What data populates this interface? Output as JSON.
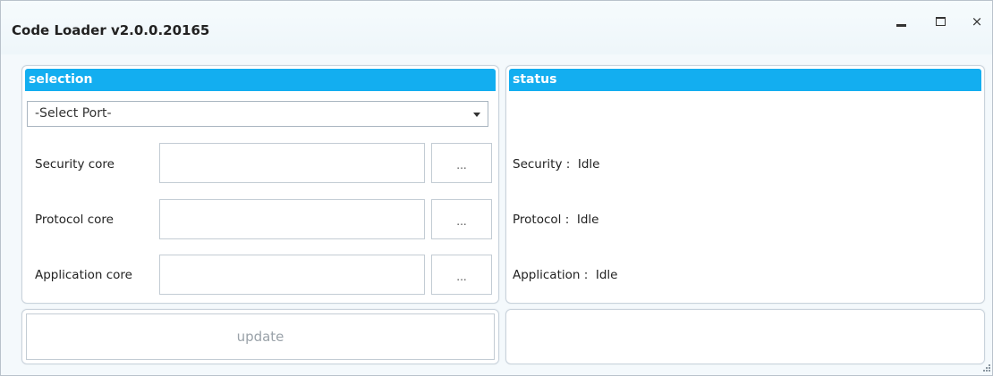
{
  "window": {
    "title": "Code Loader v2.0.0.20165",
    "controls": {
      "minimize": "minimize",
      "maximize": "maximize",
      "close": "×"
    }
  },
  "selection": {
    "header": "selection",
    "port_select": {
      "value": "-Select Port-"
    },
    "rows": [
      {
        "label": "Security core",
        "value": "",
        "browse": "..."
      },
      {
        "label": "Protocol core",
        "value": "",
        "browse": "..."
      },
      {
        "label": "Application core",
        "value": "",
        "browse": "..."
      }
    ]
  },
  "status": {
    "header": "status",
    "lines": [
      {
        "label": "Security",
        "sep": " :  ",
        "value": "Idle"
      },
      {
        "label": "Protocol",
        "sep": " :  ",
        "value": "Idle"
      },
      {
        "label": "Application",
        "sep": " :  ",
        "value": "Idle"
      }
    ]
  },
  "actions": {
    "update_label": "update"
  },
  "colors": {
    "accent": "#13aef0",
    "panel_border": "#c9d3dc",
    "disabled_text": "#9aa2a9"
  }
}
